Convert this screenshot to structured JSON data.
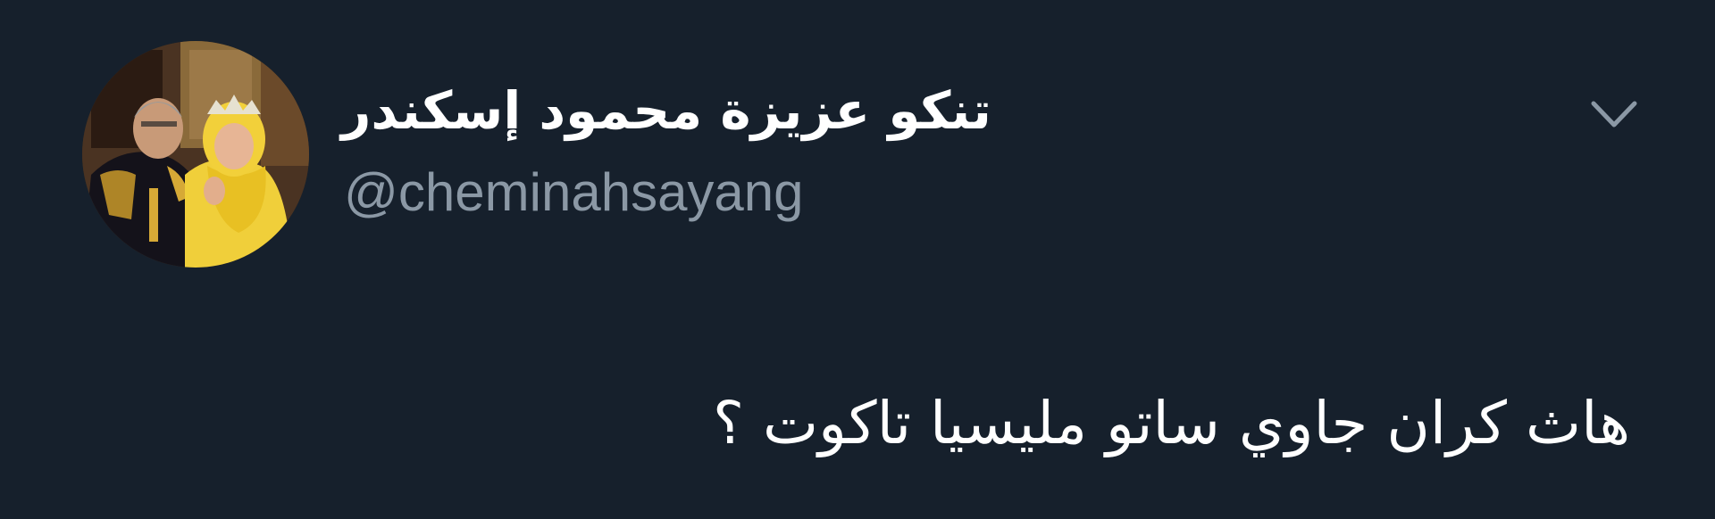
{
  "author": {
    "display_name": "تنكو عزيزة محمود إسكندر",
    "handle": "@cheminahsayang",
    "avatar": "profile-photo-royal-couple"
  },
  "tweet": {
    "text": "هاث كران جاوي ساتو مليسيا تاكوت ؟"
  },
  "menu": {
    "icon": "chevron-down-icon"
  },
  "colors": {
    "background": "#16202c",
    "primary_text": "#ffffff",
    "secondary_text": "#8b98a5"
  }
}
